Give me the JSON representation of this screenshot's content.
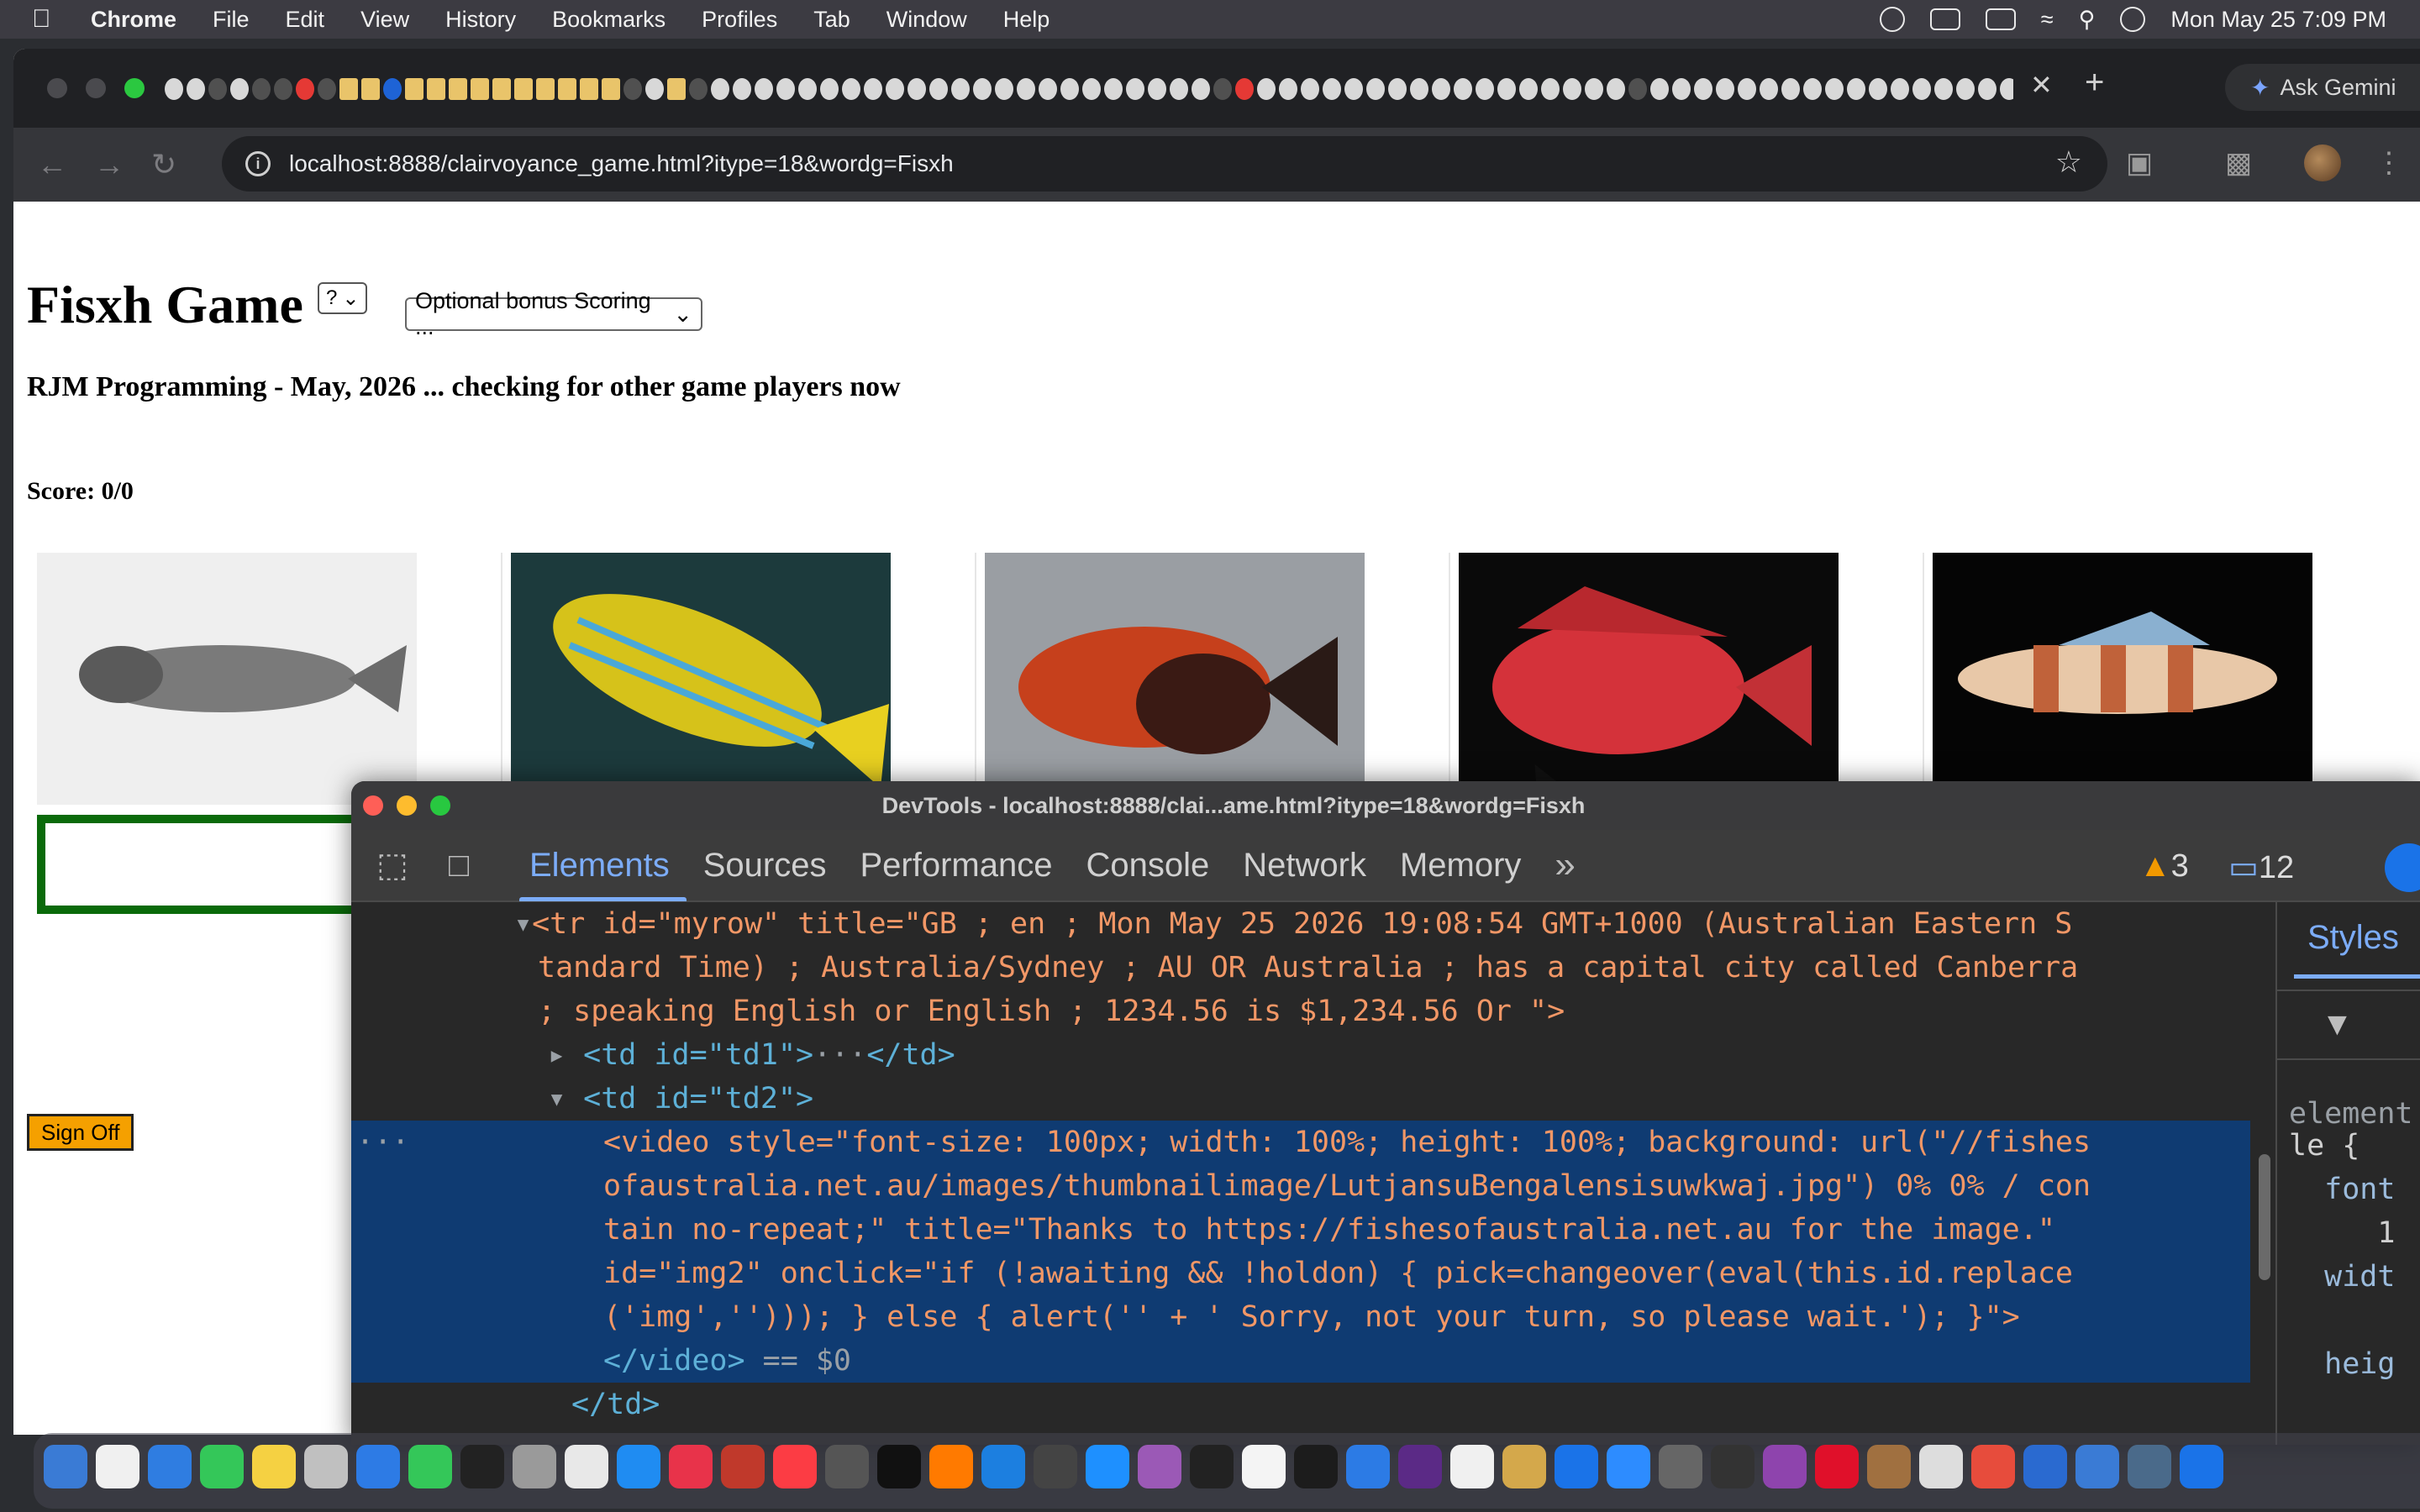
{
  "menubar": {
    "app": "Chrome",
    "items": [
      "File",
      "Edit",
      "View",
      "History",
      "Bookmarks",
      "Profiles",
      "Tab",
      "Window",
      "Help"
    ],
    "clock": "Mon May 25  7:09 PM"
  },
  "browser": {
    "tab_close": "✕",
    "new_tab": "+",
    "ask_gemini": "Ask Gemini",
    "url": "localhost:8888/clairvoyance_game.html?itype=18&wordg=Fisxh"
  },
  "page": {
    "title": "Fisxh Game",
    "help_select": "?",
    "bonus_select": "Optional bonus Scoring ...",
    "subtitle": "RJM Programming - May, 2026 ... checking for other game players now",
    "score": "Score: 0/0",
    "sign_off": "Sign Off",
    "fish_images": [
      {
        "name": "grey-line-drawing-fish",
        "bg": "#efefef",
        "body": "#6b6b6b"
      },
      {
        "name": "yellow-striped-snapper",
        "bg": "#1c3a3c",
        "body": "#d6c21a"
      },
      {
        "name": "red-goby",
        "bg": "#9a9ea3",
        "body": "#c6401c"
      },
      {
        "name": "red-scorpionfish",
        "bg": "#0a0a0a",
        "body": "#d4323a"
      },
      {
        "name": "banded-goby",
        "bg": "#050505",
        "body": "#e8c8a8"
      }
    ]
  },
  "devtools": {
    "title": "DevTools - localhost:8888/clai...ame.html?itype=18&wordg=Fisxh",
    "tabs": [
      "Elements",
      "Sources",
      "Performance",
      "Console",
      "Network",
      "Memory"
    ],
    "more_tabs": "»",
    "warnings": "3",
    "messages": "12",
    "styles_tab": "Styles",
    "styles_lines": [
      "element",
      "le {",
      "  font",
      "     1",
      "  widt",
      "",
      "  heig"
    ],
    "dom": {
      "tr_line1": "<tr id=\"myrow\" title=\"GB ; en ; Mon May 25 2026 19:08:54 GMT+1000 (Australian Eastern S",
      "tr_line2": "tandard Time) ; Australia/Sydney ; AU OR Australia ; has a capital city called Canberra",
      "tr_line3": "; speaking English or English ; 1234.56 is $1,234.56 Or \">",
      "td1": "<td id=\"td1\">",
      "td1_end": "</td>",
      "td2": "<td id=\"td2\">",
      "video1": "<video style=\"font-size: 100px; width: 100%; height: 100%; background: url(\"//fishes",
      "video2": "ofaustralia.net.au/images/thumbnailimage/LutjansuBengalensisuwkwaj.jpg\") 0% 0% / con",
      "video3": "tain no-repeat;\" title=\"Thanks to https://fishesofaustralia.net.au for the image.\"",
      "video4": "id=\"img2\" onclick=\"if (!awaiting && !holdon) { pick=changeover(eval(this.id.replace",
      "video5": "('img',''))); } else { alert('' + ' Sorry, not your turn, so please wait.'); }\">",
      "video_end": "</video>",
      "eq": " == $0",
      "td_end": "</td>",
      "ellipsis": "···"
    }
  }
}
